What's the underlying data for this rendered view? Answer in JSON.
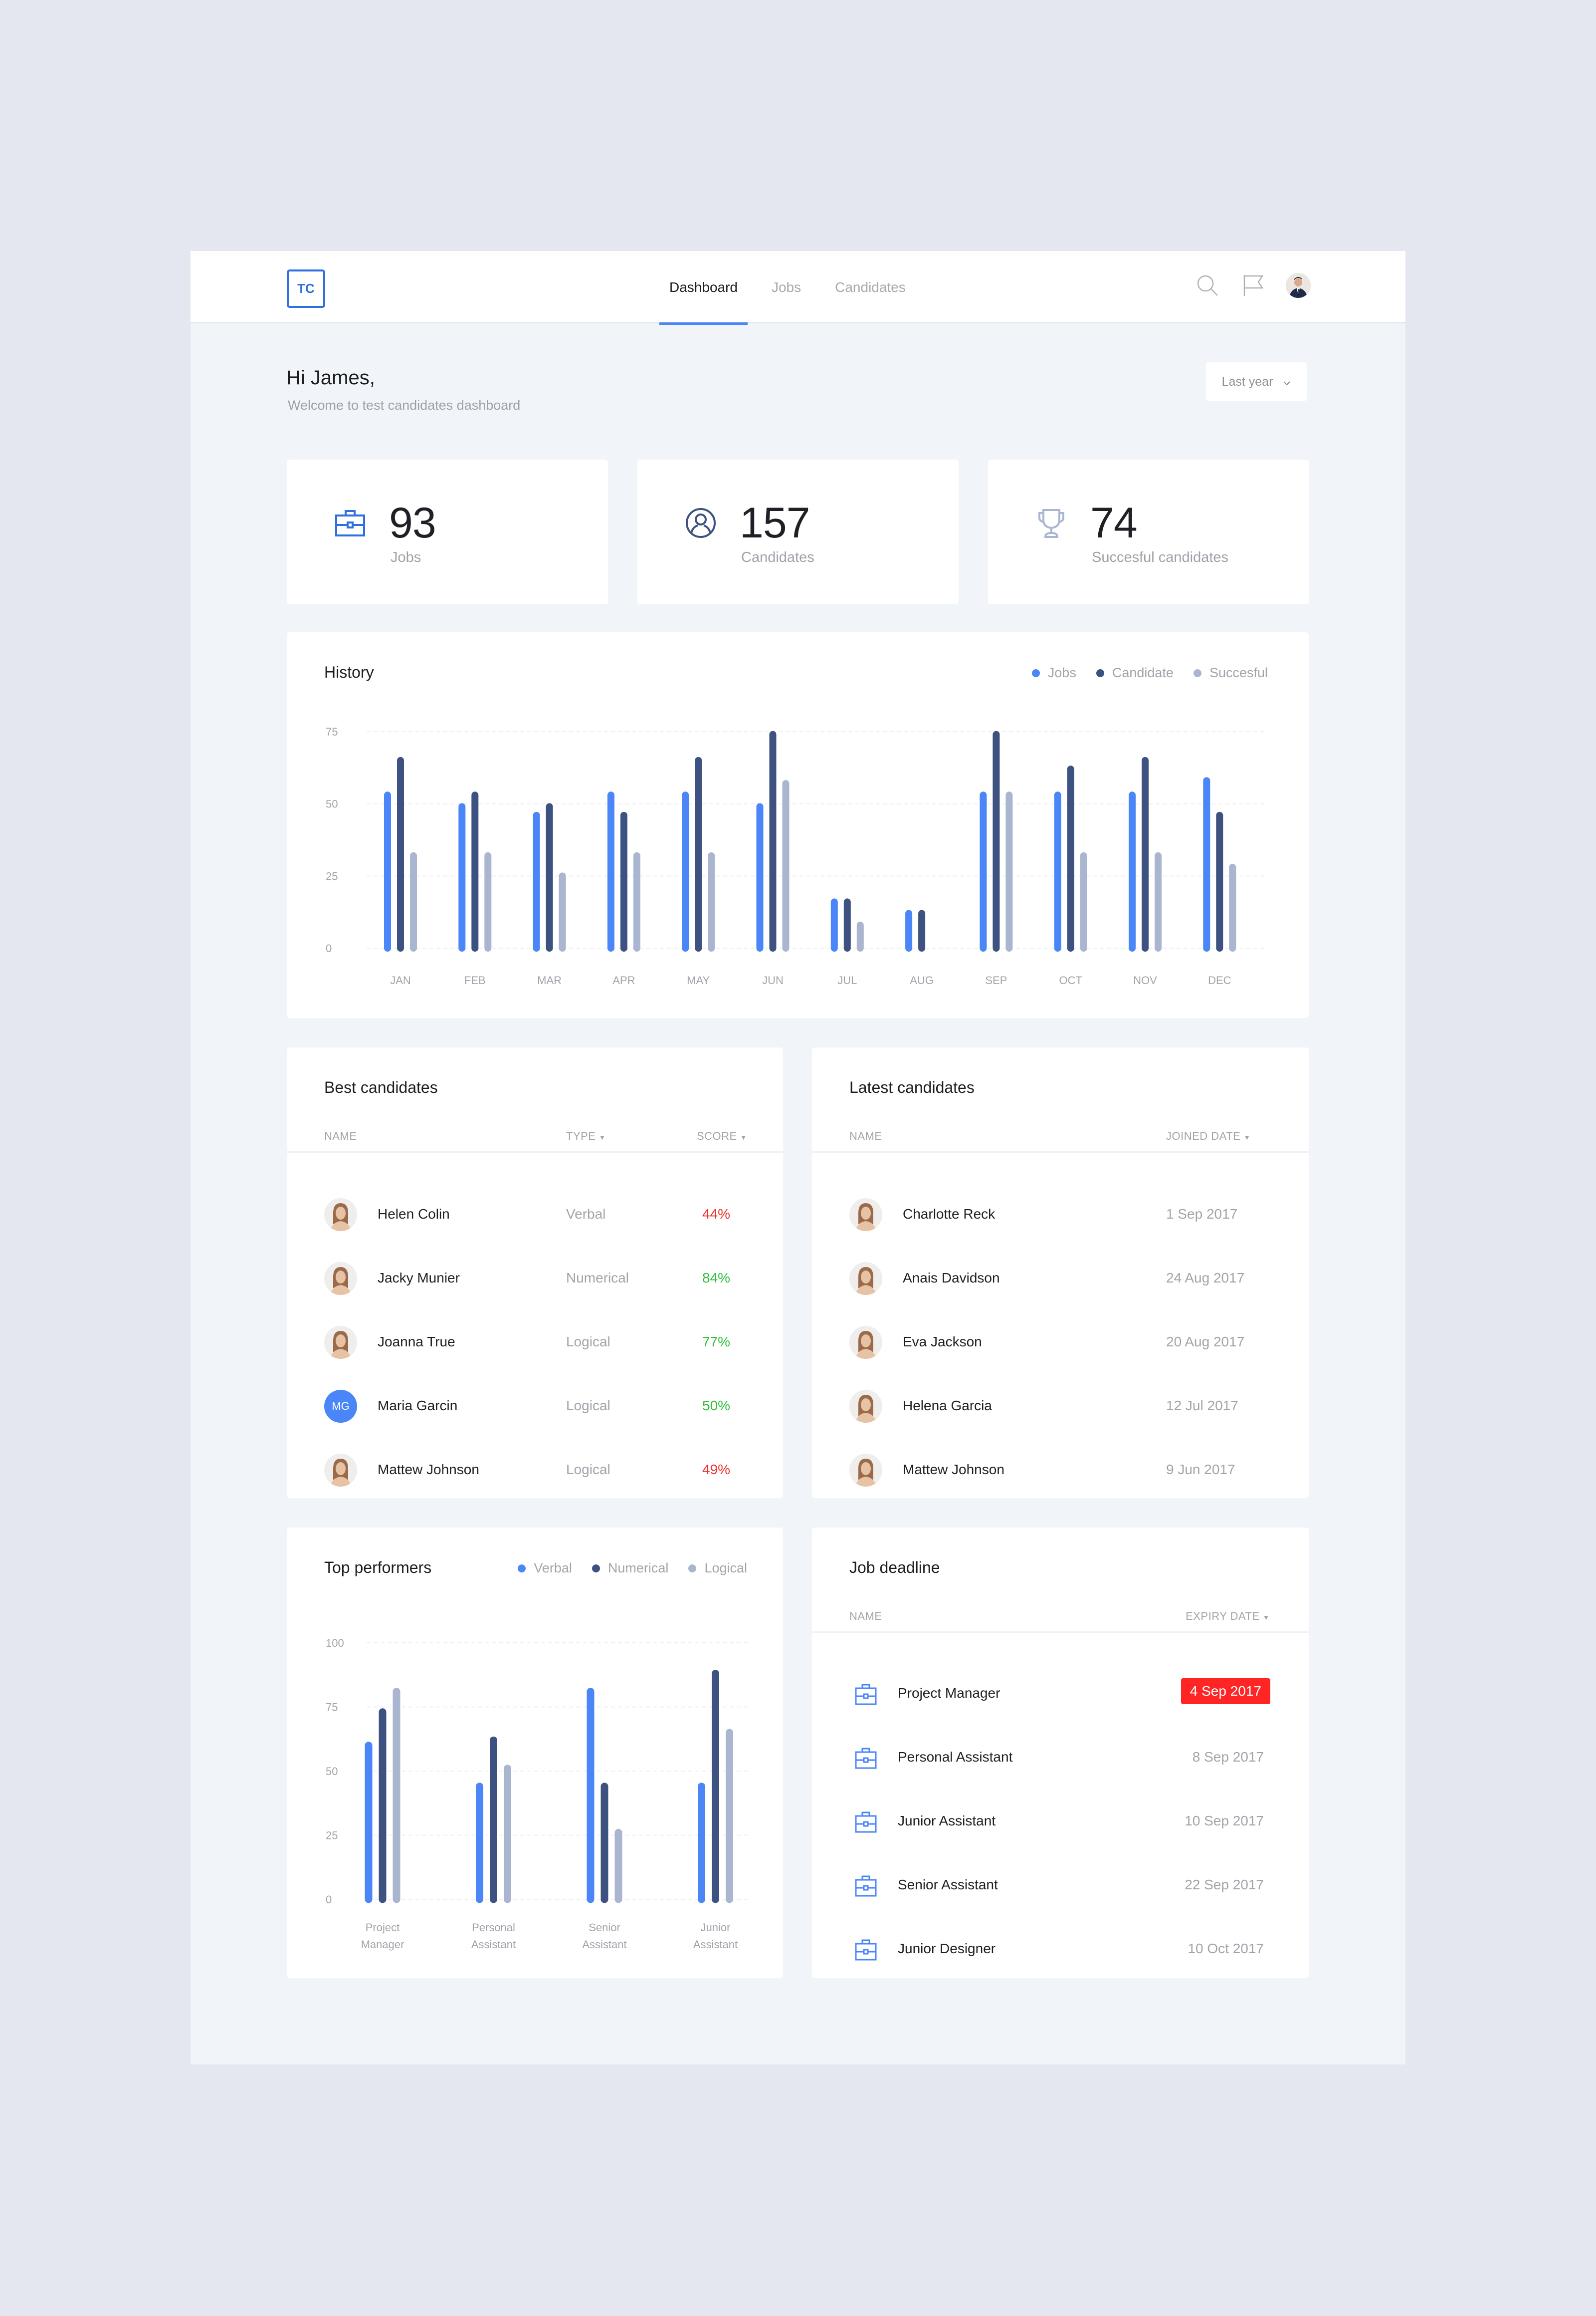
{
  "colors": {
    "accent": "#4a86f7",
    "logo": "#2f6fe0",
    "series_primary": "#4a86f7",
    "series_secondary": "#3d5280",
    "series_tertiary": "#aab6cf",
    "score_good": "#2fbf3a",
    "score_bad": "#f0302d",
    "urgent": "#ff2525"
  },
  "header": {
    "logo_text": "TC",
    "nav": [
      {
        "label": "Dashboard",
        "active": true
      },
      {
        "label": "Jobs",
        "active": false
      },
      {
        "label": "Candidates",
        "active": false
      }
    ],
    "icons": [
      "search-icon",
      "flag-icon",
      "user-avatar"
    ]
  },
  "greeting": {
    "title": "Hi James,",
    "subtitle": "Welcome to test candidates dashboard"
  },
  "period_select": {
    "value": "Last year",
    "icon": "chevron-down-icon"
  },
  "stats": [
    {
      "icon": "briefcase-icon",
      "value": "93",
      "label": "Jobs"
    },
    {
      "icon": "user-circle-icon",
      "value": "157",
      "label": "Candidates"
    },
    {
      "icon": "trophy-icon",
      "value": "74",
      "label": "Succesful candidates"
    }
  ],
  "history": {
    "title": "History",
    "legend": [
      "Jobs",
      "Candidate",
      "Succesful"
    ]
  },
  "top_performers": {
    "title": "Top performers",
    "legend": [
      "Verbal",
      "Numerical",
      "Logical"
    ]
  },
  "chart_data": [
    {
      "type": "bar",
      "title": "History",
      "categories": [
        "JAN",
        "FEB",
        "MAR",
        "APR",
        "MAY",
        "JUN",
        "JUL",
        "AUG",
        "SEP",
        "OCT",
        "NOV",
        "DEC"
      ],
      "series": [
        {
          "name": "Jobs",
          "values": [
            53,
            49,
            46,
            53,
            53,
            49,
            16,
            12,
            53,
            53,
            53,
            58
          ]
        },
        {
          "name": "Candidate",
          "values": [
            65,
            53,
            49,
            46,
            65,
            74,
            16,
            12,
            74,
            62,
            65,
            46
          ]
        },
        {
          "name": "Succesful",
          "values": [
            32,
            32,
            25,
            32,
            32,
            57,
            8,
            0,
            53,
            32,
            32,
            28
          ]
        }
      ],
      "yticks": [
        0,
        25,
        50,
        75
      ],
      "ylim": [
        0,
        75
      ],
      "xlabel": "",
      "ylabel": "",
      "grid": true,
      "legend_position": "top-right"
    },
    {
      "type": "bar",
      "title": "Top performers",
      "categories": [
        [
          "Project",
          "Manager"
        ],
        [
          "Personal",
          "Assistant"
        ],
        [
          "Senior",
          "Assistant"
        ],
        [
          "Junior",
          "Assistant"
        ]
      ],
      "series": [
        {
          "name": "Verbal",
          "values": [
            60,
            44,
            81,
            44
          ]
        },
        {
          "name": "Numerical",
          "values": [
            73,
            62,
            44,
            88
          ]
        },
        {
          "name": "Logical",
          "values": [
            81,
            51,
            26,
            65
          ]
        }
      ],
      "yticks": [
        0,
        25,
        50,
        75,
        100
      ],
      "ylim": [
        0,
        100
      ],
      "xlabel": "",
      "ylabel": "",
      "grid": true,
      "legend_position": "top-right"
    }
  ],
  "best_candidates": {
    "title": "Best candidates",
    "columns": [
      "NAME",
      "TYPE",
      "SCORE"
    ],
    "rows": [
      {
        "name": "Helen Colin",
        "type": "Verbal",
        "score": "44%",
        "status": "bad",
        "avatar": "photo"
      },
      {
        "name": "Jacky Munier",
        "type": "Numerical",
        "score": "84%",
        "status": "good",
        "avatar": "photo"
      },
      {
        "name": "Joanna True",
        "type": "Logical",
        "score": "77%",
        "status": "good",
        "avatar": "photo"
      },
      {
        "name": "Maria Garcin",
        "type": "Logical",
        "score": "50%",
        "status": "good",
        "avatar": "MG"
      },
      {
        "name": "Mattew Johnson",
        "type": "Logical",
        "score": "49%",
        "status": "bad",
        "avatar": "photo"
      }
    ]
  },
  "latest_candidates": {
    "title": "Latest candidates",
    "columns": [
      "NAME",
      "JOINED DATE"
    ],
    "rows": [
      {
        "name": "Charlotte Reck",
        "date": "1 Sep 2017"
      },
      {
        "name": "Anais Davidson",
        "date": "24 Aug 2017"
      },
      {
        "name": "Eva Jackson",
        "date": "20 Aug 2017"
      },
      {
        "name": "Helena Garcia",
        "date": "12 Jul 2017"
      },
      {
        "name": "Mattew Johnson",
        "date": "9 Jun 2017"
      }
    ]
  },
  "job_deadline": {
    "title": "Job deadline",
    "columns": [
      "NAME",
      "EXPIRY DATE"
    ],
    "rows": [
      {
        "name": "Project Manager",
        "date": "4 Sep 2017",
        "urgent": true
      },
      {
        "name": "Personal Assistant",
        "date": "8 Sep 2017",
        "urgent": false
      },
      {
        "name": "Junior Assistant",
        "date": "10 Sep 2017",
        "urgent": false
      },
      {
        "name": "Senior Assistant",
        "date": "22 Sep 2017",
        "urgent": false
      },
      {
        "name": "Junior Designer",
        "date": "10 Oct 2017",
        "urgent": false
      }
    ]
  }
}
